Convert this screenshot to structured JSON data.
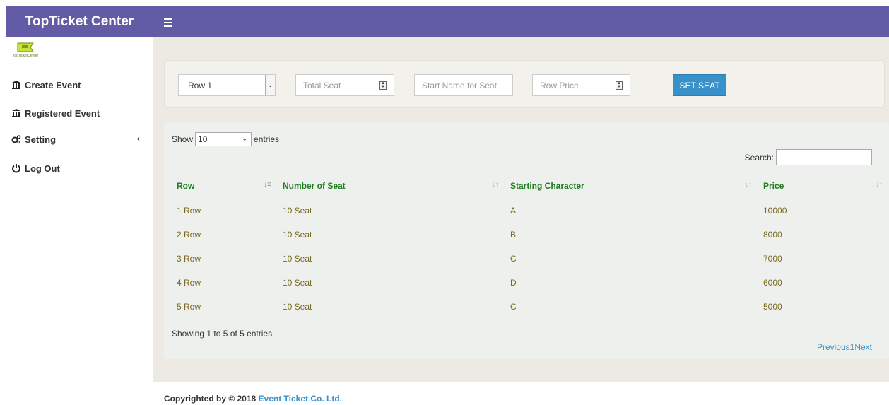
{
  "header": {
    "brand": "TopTicket Center"
  },
  "sidebar": {
    "logo_text": "TopTicketCenter",
    "items": [
      {
        "label": "Create Event",
        "icon": "bank-icon"
      },
      {
        "label": "Registered Event",
        "icon": "bank-icon"
      },
      {
        "label": "Setting",
        "icon": "cogs-icon",
        "chevron": "‹"
      },
      {
        "label": "Log Out",
        "icon": "power-icon"
      }
    ]
  },
  "filters": {
    "row_select_value": "Row 1",
    "total_seat_placeholder": "Total Seat",
    "start_name_placeholder": "Start Name for Seat",
    "row_price_placeholder": "Row Price",
    "set_seat_label": "SET SEAT"
  },
  "table": {
    "show_label": "Show",
    "entries_value": "10",
    "entries_label": "entries",
    "search_label": "Search:",
    "columns": [
      "Row",
      "Number of Seat",
      "Starting Character",
      "Price"
    ],
    "rows": [
      [
        "1 Row",
        "10 Seat",
        "A",
        "10000"
      ],
      [
        "2 Row",
        "10 Seat",
        "B",
        "8000"
      ],
      [
        "3 Row",
        "10 Seat",
        "C",
        "7000"
      ],
      [
        "4 Row",
        "10 Seat",
        "D",
        "6000"
      ],
      [
        "5 Row",
        "10 Seat",
        "C",
        "5000"
      ]
    ],
    "info": "Showing 1 to 5 of 5 entries",
    "pager": {
      "previous": "Previous",
      "page": "1",
      "next": "Next"
    }
  },
  "footer": {
    "prefix": "Copyrighted by © 2018 ",
    "company": "Event Ticket Co. Ltd."
  },
  "colors": {
    "header_bg": "#625ba6",
    "accent": "#3891c9",
    "header_text": "#1e7d1e",
    "cell_text": "#7a6a1e"
  }
}
